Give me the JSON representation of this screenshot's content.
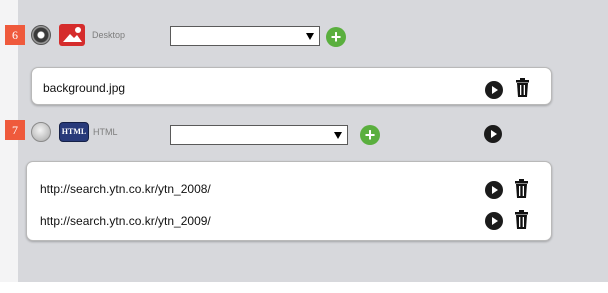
{
  "sources": [
    {
      "badge": "6",
      "selected": true,
      "icon": "desktop-background-icon",
      "label": "Desktop",
      "select_value": "",
      "items": [
        {
          "text": "background.jpg"
        }
      ]
    },
    {
      "badge": "7",
      "selected": false,
      "icon": "html-icon",
      "icon_text": "HTML",
      "label": "HTML",
      "select_value": "",
      "items": [
        {
          "text": "http://search.ytn.co.kr/ytn_2008/"
        },
        {
          "text": "http://search.ytn.co.kr/ytn_2009/"
        }
      ]
    }
  ],
  "colors": {
    "panel_bg": "#d7d8dc",
    "badge": "#ef5a3c",
    "add_green": "#5aaf3e",
    "desktop_icon": "#d52c2c",
    "html_icon": "#283a7a"
  }
}
